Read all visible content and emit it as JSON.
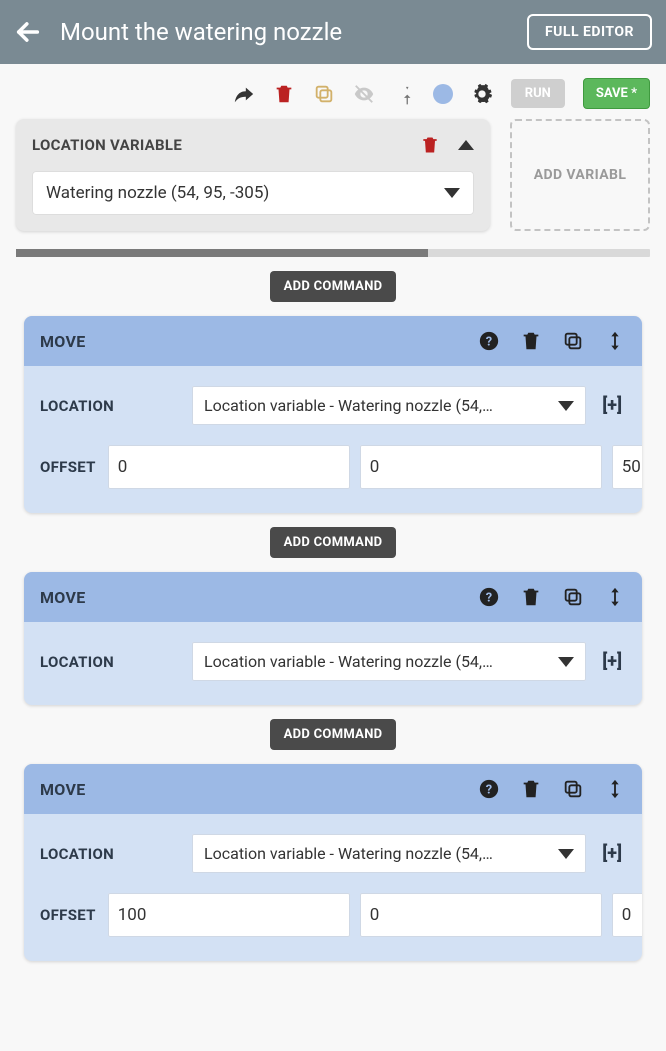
{
  "topbar": {
    "title": "Mount the watering nozzle",
    "full_editor": "FULL EDITOR"
  },
  "toolbar": {
    "run": "RUN",
    "save": "SAVE *"
  },
  "locvar": {
    "title": "LOCATION VARIABLE",
    "selected": "Watering nozzle (54, 95, -305)"
  },
  "add_variable": "ADD VARIABL",
  "add_command": "ADD COMMAND",
  "commands": [
    {
      "title": "MOVE",
      "location_label": "LOCATION",
      "location_value": "Location variable - Watering nozzle (54,…",
      "offset_label": "OFFSET",
      "offsets": [
        "0",
        "0",
        "50"
      ]
    },
    {
      "title": "MOVE",
      "location_label": "LOCATION",
      "location_value": "Location variable - Watering nozzle (54,…"
    },
    {
      "title": "MOVE",
      "location_label": "LOCATION",
      "location_value": "Location variable - Watering nozzle (54,…",
      "offset_label": "OFFSET",
      "offsets": [
        "100",
        "0",
        "0"
      ]
    }
  ]
}
